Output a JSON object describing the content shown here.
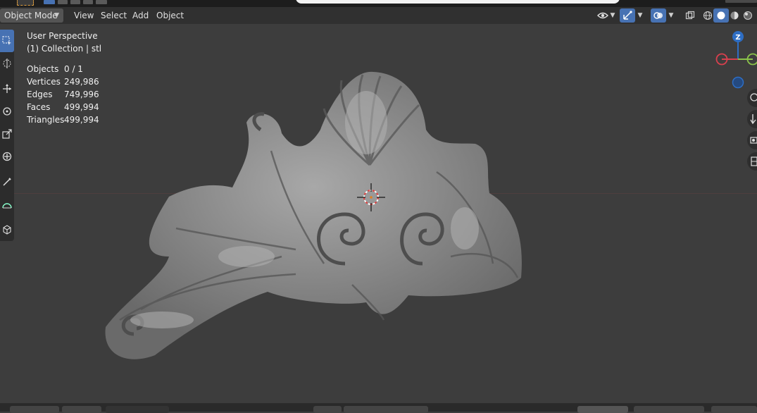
{
  "header": {
    "mode_label": "Object Mode",
    "menu": [
      "View",
      "Select",
      "Add",
      "Object"
    ]
  },
  "overlay": {
    "perspective": "User Perspective",
    "collection": "(1) Collection | stl",
    "stats": [
      {
        "label": "Objects",
        "value": "0 / 1"
      },
      {
        "label": "Vertices",
        "value": "249,986"
      },
      {
        "label": "Edges",
        "value": "749,996"
      },
      {
        "label": "Faces",
        "value": "499,994"
      },
      {
        "label": "Triangles",
        "value": "499,994"
      }
    ]
  },
  "gizmo": {
    "z_label": "Z",
    "colors": {
      "x": "#d8404e",
      "y": "#8bc34a",
      "z": "#2e6ec4"
    }
  },
  "toolbar": {
    "tools": [
      "select-box-icon",
      "cursor-icon",
      "move-icon",
      "rotate-icon",
      "scale-icon",
      "transform-icon",
      "annotate-icon",
      "measure-icon",
      "add-cube-icon"
    ]
  },
  "header_icons": [
    "visibility-icon",
    "gizmo-toggle-icon",
    "overlay-icon",
    "xray-icon",
    "shading-wireframe-icon",
    "shading-solid-icon",
    "shading-material-icon",
    "shading-rendered-icon"
  ],
  "accent": "#4772b3"
}
